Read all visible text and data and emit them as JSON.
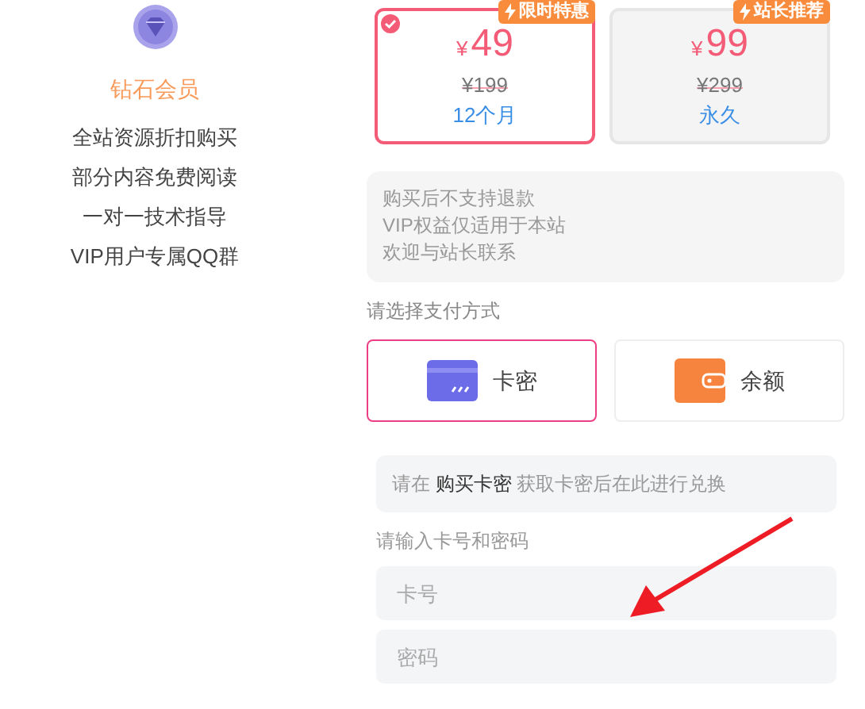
{
  "membership": {
    "title": "钻石会员",
    "benefits": [
      "全站资源折扣购买",
      "部分内容免费阅读",
      "一对一技术指导",
      "VIP用户专属QQ群"
    ]
  },
  "plans": [
    {
      "badge": "限时特惠",
      "currency": "¥",
      "price": "49",
      "original_price": "¥199",
      "duration": "12个月",
      "selected": true
    },
    {
      "badge": "站长推荐",
      "currency": "¥",
      "price": "99",
      "original_price": "¥299",
      "duration": "永久",
      "selected": false
    }
  ],
  "notice": [
    "购买后不支持退款",
    "VIP权益仅适用于本站",
    "欢迎与站长联系"
  ],
  "payment_label": "请选择支付方式",
  "payment_methods": [
    {
      "kind": "card",
      "label": "卡密",
      "selected": true
    },
    {
      "kind": "balance",
      "label": "余额",
      "selected": false
    }
  ],
  "redeem_hint": {
    "before": "请在",
    "link": "购买卡密",
    "after": "获取卡密后在此进行兑换"
  },
  "input_label": "请输入卡号和密码",
  "fields": [
    {
      "placeholder": "卡号"
    },
    {
      "placeholder": "密码"
    }
  ]
}
